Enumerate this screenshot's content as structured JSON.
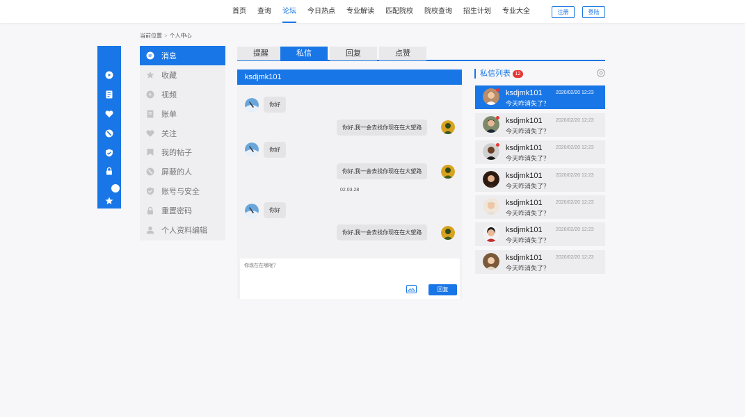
{
  "nav": {
    "items": [
      "首页",
      "查询",
      "论坛",
      "今日热点",
      "专业解读",
      "匹配院校",
      "院校查询",
      "招生计划",
      "专业大全"
    ],
    "active_index": 2,
    "register_label": "注册",
    "login_label": "登陆"
  },
  "breadcrumb": {
    "label": "当前位置",
    "separator": ">",
    "current": "个人中心"
  },
  "rail_icons": [
    "play-icon",
    "document-icon",
    "heart-icon",
    "block-icon",
    "shield-icon",
    "lock-icon",
    "star-icon"
  ],
  "menu": {
    "items": [
      {
        "label": "消息",
        "icon": "message-icon",
        "active": true
      },
      {
        "label": "收藏",
        "icon": "star-icon",
        "active": false
      },
      {
        "label": "视频",
        "icon": "play-icon",
        "active": false
      },
      {
        "label": "账单",
        "icon": "document-icon",
        "active": false
      },
      {
        "label": "关注",
        "icon": "heart-icon",
        "active": false
      },
      {
        "label": "我的帖子",
        "icon": "post-icon",
        "active": false
      },
      {
        "label": "屏蔽的人",
        "icon": "block-icon",
        "active": false
      },
      {
        "label": "账号与安全",
        "icon": "shield-icon",
        "active": false
      },
      {
        "label": "重置密码",
        "icon": "lock-icon",
        "active": false
      },
      {
        "label": "个人资料编辑",
        "icon": "user-icon",
        "active": false
      }
    ]
  },
  "tabs": [
    {
      "label": "提醒",
      "active": false
    },
    {
      "label": "私信",
      "active": true
    },
    {
      "label": "回复",
      "active": false
    },
    {
      "label": "点赞",
      "active": false
    }
  ],
  "chat": {
    "title": "ksdjmk101",
    "messages": [
      {
        "side": "left",
        "text": "你好"
      },
      {
        "side": "right",
        "text": "你好,我一会去找你现在在大望路"
      },
      {
        "side": "left",
        "text": "你好"
      },
      {
        "side": "right",
        "text": "你好,我一会去找你现在在大望路"
      },
      {
        "side": "time",
        "text": "02.03.28"
      },
      {
        "side": "left",
        "text": "你好"
      },
      {
        "side": "right",
        "text": "你好,我一会去找你现在在大望路"
      }
    ],
    "input_placeholder": "你现在在哪呢？",
    "reply_label": "回复"
  },
  "pm_list": {
    "title": "私信列表",
    "badge": "12",
    "items": [
      {
        "name": "ksdjmk101",
        "time": "2020/02/20 12:23",
        "text": "今天咋消失了？",
        "active": true,
        "unread": true
      },
      {
        "name": "ksdjmk101",
        "time": "2020/02/20 12:23",
        "text": "今天咋消失了？",
        "active": false,
        "unread": true
      },
      {
        "name": "ksdjmk101",
        "time": "2020/02/20 12:23",
        "text": "今天咋消失了？",
        "active": false,
        "unread": true
      },
      {
        "name": "ksdjmk101",
        "time": "2020/02/20 12:23",
        "text": "今天咋消失了？",
        "active": false,
        "unread": false
      },
      {
        "name": "ksdjmk101",
        "time": "2020/02/20 12:23",
        "text": "今天咋消失了？",
        "active": false,
        "unread": false
      },
      {
        "name": "ksdjmk101",
        "time": "2020/02/20 12:23",
        "text": "今天咋消失了？",
        "active": false,
        "unread": false
      },
      {
        "name": "ksdjmk101",
        "time": "2020/02/20 12:23",
        "text": "今天咋消失了？",
        "active": false,
        "unread": false
      }
    ]
  },
  "colors": {
    "accent": "#1976e6",
    "badge": "#e53935"
  }
}
